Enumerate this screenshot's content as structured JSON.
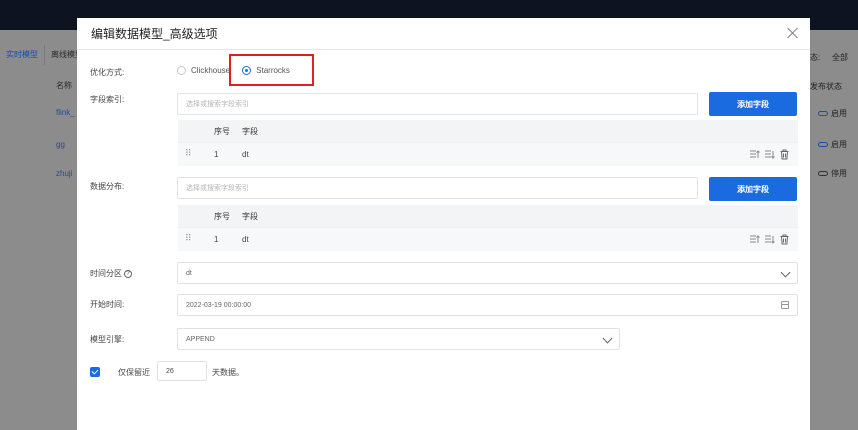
{
  "background": {
    "tabs": [
      {
        "label": "实时模型",
        "active": true
      },
      {
        "label": "离线模型",
        "active": false
      }
    ],
    "column_name_header": "名称",
    "rows": [
      "flink_",
      "gg",
      "zhuji"
    ],
    "right_filter_prefix": "态:",
    "right_filter_all": "全部",
    "publish_status_header": "发布状态",
    "statuses": [
      "启用",
      "启用",
      "停用"
    ]
  },
  "modal": {
    "title": "编辑数据模型_高级选项",
    "optimize_label": "优化方式:",
    "options": [
      {
        "label": "Clickhouse",
        "selected": false
      },
      {
        "label": "Starrocks",
        "selected": true
      }
    ],
    "field_index": {
      "label": "字段索引:",
      "placeholder": "选择或搜索字段索引",
      "button": "添加字段",
      "col_seq": "序号",
      "col_field": "字段",
      "rows": [
        {
          "seq": "1",
          "field": "dt"
        }
      ]
    },
    "distribution": {
      "label": "数据分布:",
      "placeholder": "选择或搜索字段索引",
      "button": "添加字段",
      "col_seq": "序号",
      "col_field": "字段",
      "rows": [
        {
          "seq": "1",
          "field": "dt"
        }
      ]
    },
    "time_partition": {
      "label": "时间分区",
      "value": "dt"
    },
    "start_time": {
      "label": "开始时间:",
      "value": "2022-03-19 00:00:00"
    },
    "engine": {
      "label": "模型引擎:",
      "value": "APPEND"
    },
    "retain": {
      "checked": true,
      "prefix": "仅保留近",
      "days": "26",
      "suffix": "天数据。"
    }
  },
  "colors": {
    "primary": "#1a6be0",
    "highlight": "#e02020"
  }
}
